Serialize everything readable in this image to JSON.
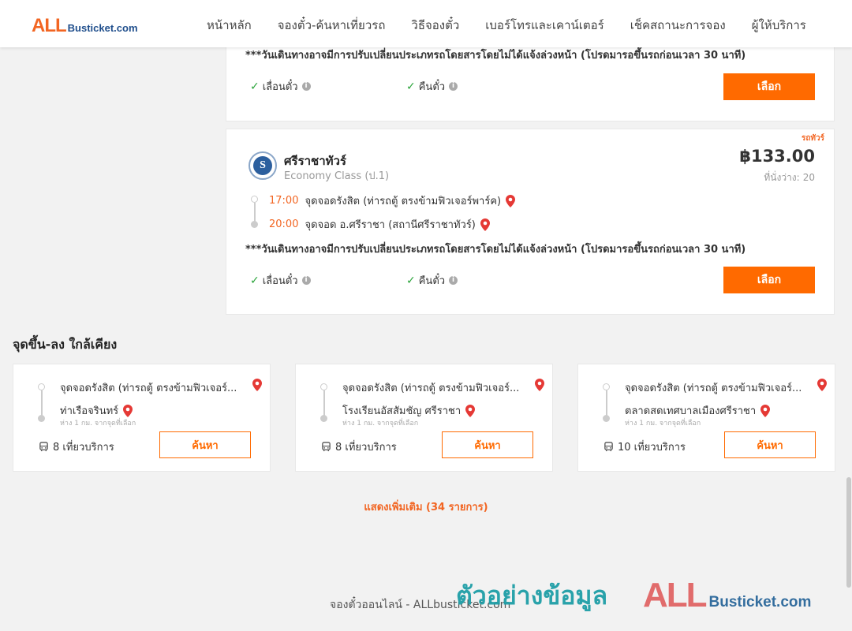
{
  "header": {
    "logo_all": "ALL",
    "logo_rest": "Busticket.com",
    "nav": [
      "หน้าหลัก",
      "จองตั๋ว-ค้นหาเที่ยวรถ",
      "วิธีจองตั๋ว",
      "เบอร์โทรและเคาน์เตอร์",
      "เช็คสถานะการจอง",
      "ผู้ให้บริการ"
    ]
  },
  "route_card_1": {
    "notice": "***วันเดินทางอาจมีการปรับเปลี่ยนประเภทรถโดยสารโดยไม่ได้แจ้งล่วงหน้า (โปรดมารอขึ้นรถก่อนเวลา 30 นาที)",
    "feature_reschedule": "เลื่อนตั๋ว",
    "feature_refund": "คืนตั๋ว",
    "select_label": "เลือก"
  },
  "route_card_2": {
    "tag": "รถทัวร์",
    "operator_name": "ศรีราชาทัวร์",
    "operator_class": "Economy Class (ป.1)",
    "logo_letter": "S",
    "price": "฿133.00",
    "seats_label": "ที่นั่งว่าง:",
    "seats_value": "20",
    "depart_time": "17:00",
    "depart_stop": "จุดจอดรังสิต (ท่ารถตู้ ตรงข้ามฟิวเจอร์พาร์ค)",
    "arrive_time": "20:00",
    "arrive_stop": "จุดจอด อ.ศรีราชา (สถานีศรีราชาทัวร์)",
    "notice": "***วันเดินทางอาจมีการปรับเปลี่ยนประเภทรถโดยสารโดยไม่ได้แจ้งล่วงหน้า (โปรดมารอขึ้นรถก่อนเวลา 30 นาที)",
    "feature_reschedule": "เลื่อนตั๋ว",
    "feature_refund": "คืนตั๋ว",
    "select_label": "เลือก"
  },
  "nearby": {
    "title": "จุดขึ้น-ลง ใกล้เคียง",
    "cards": [
      {
        "from": "จุดจอดรังสิต (ท่ารถตู้ ตรงข้ามฟิวเจอร์...",
        "to": "ท่าเรือจรินทร์",
        "distance": "ห่าง 1 กม. จากจุดที่เลือก",
        "trips": "8 เที่ยวบริการ",
        "button": "ค้นหา"
      },
      {
        "from": "จุดจอดรังสิต (ท่ารถตู้ ตรงข้ามฟิวเจอร์...",
        "to": "โรงเรียนอัสสัมชัญ ศรีราชา",
        "distance": "ห่าง 1 กม. จากจุดที่เลือก",
        "trips": "8 เที่ยวบริการ",
        "button": "ค้นหา"
      },
      {
        "from": "จุดจอดรังสิต (ท่ารถตู้ ตรงข้ามฟิวเจอร์...",
        "to": "ตลาดสดเทศบาลเมืองศรีราชา",
        "distance": "ห่าง 1 กม. จากจุดที่เลือก",
        "trips": "10 เที่ยวบริการ",
        "button": "ค้นหา"
      }
    ],
    "show_more": "แสดงเพิ่มเติม (34 รายการ)"
  },
  "footer": {
    "text": "จองตั๋วออนไลน์ - ALLbusticket.com"
  },
  "watermark": {
    "thai": "ตัวอย่างข้อมูล",
    "logo_all": "ALL",
    "logo_rest": "Busticket.com"
  },
  "colors": {
    "accent": "#ff6a00",
    "check": "#2aa43a",
    "pin": "#e53935"
  }
}
